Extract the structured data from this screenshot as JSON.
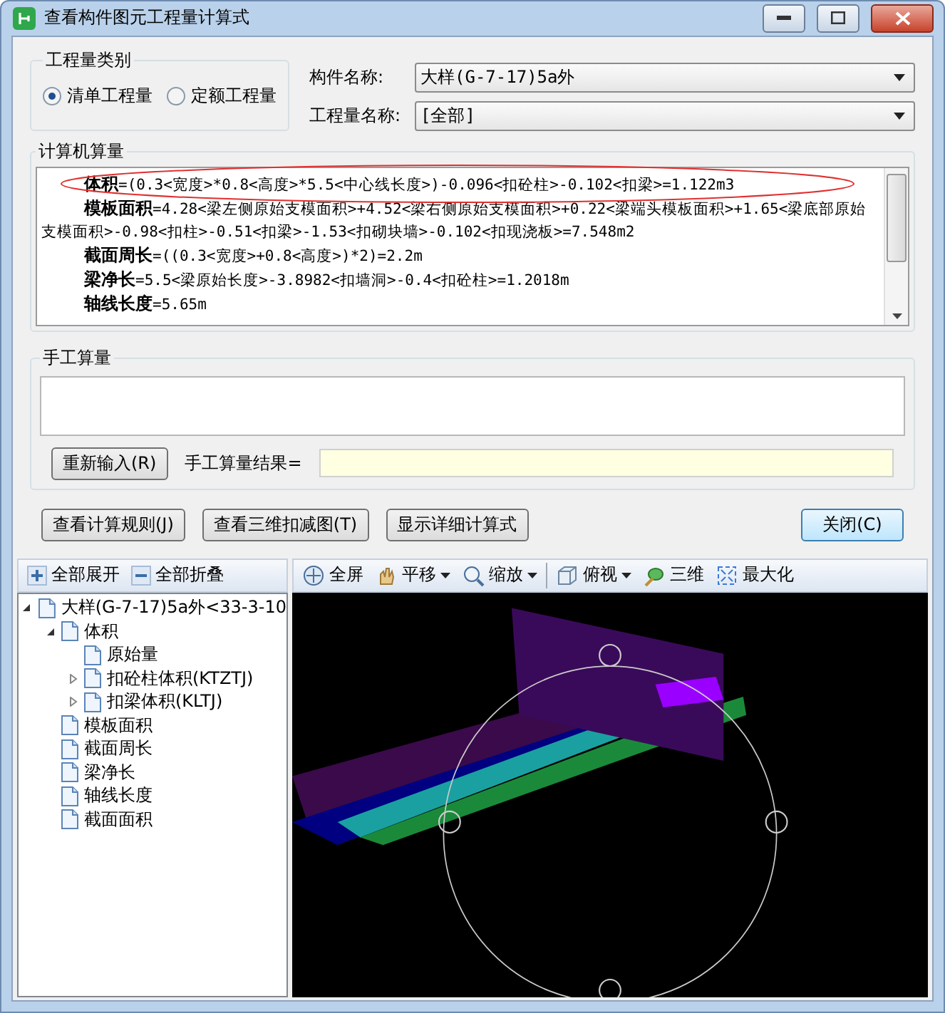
{
  "window": {
    "title": "查看构件图元工程量计算式"
  },
  "quantity_type": {
    "label": "工程量类别",
    "options": [
      {
        "label": "清单工程量",
        "selected": true
      },
      {
        "label": "定额工程量",
        "selected": false
      }
    ]
  },
  "component_name": {
    "label": "构件名称:",
    "value": "大样(G-7-17)5a外"
  },
  "quantity_name": {
    "label": "工程量名称:",
    "value": "[全部]"
  },
  "computed": {
    "label": "计算机算量",
    "lines": [
      "**体积**=(0.3<宽度>*0.8<高度>*5.5<中心线长度>)-0.096<扣砼柱>-0.102<扣梁>=1.122m3",
      "**模板面积**=4.28<梁左侧原始支模面积>+4.52<梁右侧原始支模面积>+0.22<梁端头模板面积>+1.65<梁底部原始支模面积>-0.98<扣柱>-0.51<扣梁>-1.53<扣砌块墙>-0.102<扣现浇板>=7.548m2",
      "**截面周长**=((0.3<宽度>+0.8<高度>)*2)=2.2m",
      "**梁净长**=5.5<梁原始长度>-3.8982<扣墙洞>-0.4<扣砼柱>=1.2018m",
      "**轴线长度**=5.65m"
    ]
  },
  "manual": {
    "label": "手工算量",
    "reenter_button": "重新输入(R)",
    "result_label": "手工算量结果="
  },
  "buttons": [
    {
      "label": "查看计算规则(J)",
      "default": false
    },
    {
      "label": "查看三维扣减图(T)",
      "default": false
    },
    {
      "label": "显示详细计算式",
      "default": false
    },
    {
      "label": "关闭(C)",
      "default": true
    }
  ],
  "tree_toolbar": [
    {
      "kind": "expand",
      "label": "全部展开"
    },
    {
      "kind": "collapse",
      "label": "全部折叠"
    }
  ],
  "tree": [
    {
      "label": "大样(G-7-17)5a外<33-3-10",
      "expanded": true,
      "children": [
        {
          "label": "体积",
          "expanded": true,
          "children": [
            {
              "label": "原始量"
            },
            {
              "label": "扣砼柱体积(KTZTJ)",
              "expanded": false
            },
            {
              "label": "扣梁体积(KLTJ)",
              "expanded": false
            }
          ]
        },
        {
          "label": "模板面积"
        },
        {
          "label": "截面周长"
        },
        {
          "label": "梁净长"
        },
        {
          "label": "轴线长度"
        },
        {
          "label": "截面面积"
        }
      ]
    }
  ],
  "view_toolbar": [
    {
      "kind": "fullscreen",
      "label": "全屏",
      "dropdown": false
    },
    {
      "kind": "pan",
      "label": "平移",
      "dropdown": true
    },
    {
      "kind": "zoom",
      "label": "缩放",
      "dropdown": true
    },
    {
      "kind": "top",
      "label": "俯视",
      "dropdown": true
    },
    {
      "kind": "orbit",
      "label": "三维",
      "dropdown": false
    },
    {
      "kind": "maximize",
      "label": "最大化",
      "dropdown": false
    }
  ]
}
